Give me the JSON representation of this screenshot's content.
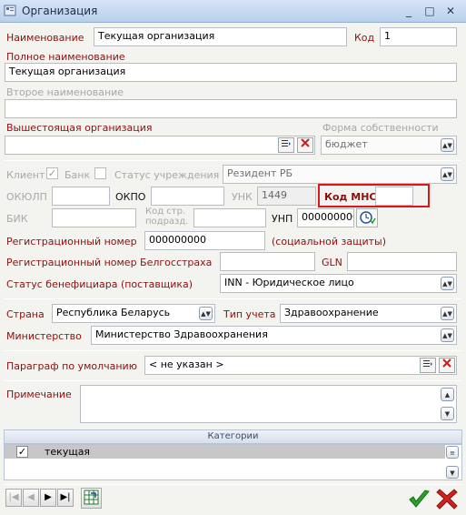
{
  "window": {
    "title": "Организация",
    "minimize": "_",
    "maximize": "□",
    "close": "✕"
  },
  "form": {
    "name_label": "Наименование",
    "name_value": "Текущая организация",
    "code_label": "Код",
    "code_value": "1",
    "full_name_label": "Полное наименование",
    "full_name_value": "Текущая организация",
    "second_name_label": "Второе наименование",
    "second_name_value": "",
    "parent_org_label": "Вышестоящая организация",
    "parent_org_value": "",
    "ownership_label": "Форма собственности",
    "ownership_value": "бюджет",
    "client_label": "Клиент",
    "client_checked": "✓",
    "bank_label": "Банк",
    "institution_status_label": "Статус учреждения",
    "institution_status_value": "Резидент РБ",
    "okulp_label": "ОКЮЛП",
    "okpo_label": "ОКПО",
    "unk_label": "УНК",
    "unk_value": "1449",
    "mns_label": "Код МНС",
    "mns_value": "",
    "bik_label": "БИК",
    "struct_code_label_1": "Код стр.",
    "struct_code_label_2": "подразд.",
    "unp_label": "УНП",
    "unp_value": "000000000",
    "reg_number_label": "Регистрационный номер",
    "reg_number_value": "000000000",
    "reg_number_note": "(социальной защиты)",
    "belgos_label": "Регистрационный номер Белгосстраха",
    "gln_label": "GLN",
    "beneficiary_label": "Статус бенефициара (поставщика)",
    "beneficiary_value": "INN - Юридическое лицо",
    "country_label": "Страна",
    "country_value": "Республика Беларусь",
    "accounting_label": "Тип учета",
    "accounting_value": "Здравоохранение",
    "ministry_label": "Министерство",
    "ministry_value": "Министерство Здравоохранения",
    "paragraph_label": "Параграф по умолчанию",
    "paragraph_value": "< не указан >",
    "note_label": "Примечание"
  },
  "categories": {
    "header": "Категории",
    "rows": [
      {
        "checked": "✓",
        "label": "текущая"
      }
    ]
  },
  "nav": {
    "first": "|◀",
    "prev": "◀",
    "next": "▶",
    "last": "▶|"
  },
  "colors": {
    "accent_red": "#8a1010",
    "highlight": "#e0141b",
    "ok_green": "#2aa02a",
    "cancel_red": "#d02020"
  }
}
